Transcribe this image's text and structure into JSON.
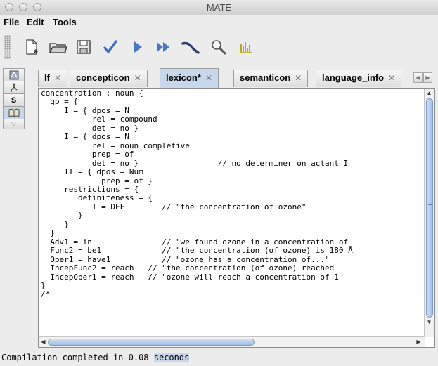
{
  "window": {
    "title": "MATE"
  },
  "menu": [
    "File",
    "Edit",
    "Tools"
  ],
  "toolbar": {
    "icons": [
      "new-file-icon",
      "open-folder-icon",
      "save-icon",
      "check-icon",
      "play-icon",
      "fast-forward-icon",
      "step-icon",
      "search-icon",
      "bar-chart-icon"
    ],
    "colors": {
      "accent": "#3b6fb6",
      "icon_blue": "#4a78c0",
      "icon_dark": "#2f3f6f",
      "chart_yellow": "#b9a000"
    }
  },
  "side_tabs": [
    {
      "icon": "graph-icon"
    },
    {
      "icon": "tree-icon"
    },
    {
      "label": "S"
    },
    {
      "icon": "book-icon"
    }
  ],
  "tabs": [
    {
      "label": "lf",
      "active": false
    },
    {
      "label": "concepticon",
      "active": false
    },
    {
      "label": "lexicon*",
      "active": true
    },
    {
      "label": "semanticon",
      "active": false
    },
    {
      "label": "language_info",
      "active": false
    }
  ],
  "editor": {
    "code": "concentration : noun {\n  gp = {\n     I = { dpos = N\n           rel = compound\n           det = no }\n     I = { dpos = N\n           rel = noun_completive\n           prep = of\n           det = no }                 // no determiner on actant I\n     II = { dpos = Num\n             prep = of }\n     restrictions = {\n        definiteness = {\n           I = DEF        // \"the concentration of ozone\"\n        }\n     }\n  }\n  Adv1 = in               // \"we found ozone in a concentration of\n  Func2 = be1             // \"the concentration (of ozone) is 180 Å\n  Oper1 = have1           // \"ozone has a concentration of...\"\n  IncepFunc2 = reach   // \"the concentration (of ozone) reached\n  IncepOper1 = reach   // \"ozone will reach a concentration of 1\n}\n/*"
  },
  "status": {
    "prefix": "Compilation completed in 0.08 ",
    "highlight": "seconds"
  }
}
